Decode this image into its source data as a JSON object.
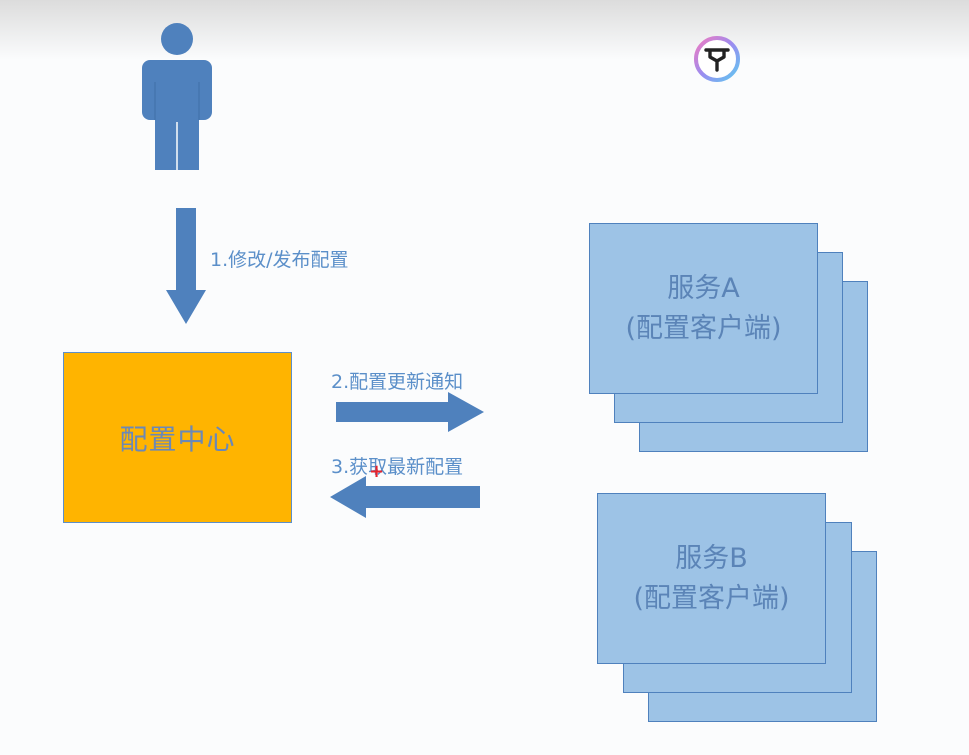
{
  "steps": {
    "step1": "1.修改/发布配置",
    "step2": "2.配置更新通知",
    "step3": "3.获取最新配置"
  },
  "config_center": {
    "label": "配置中心"
  },
  "services": [
    {
      "name": "服务A",
      "role": "(配置客户端)"
    },
    {
      "name": "服务B",
      "role": "(配置客户端)"
    }
  ],
  "colors": {
    "arrow": "#4f81bd",
    "label_text": "#5b8fc9",
    "config_center_fill": "#ffb400",
    "service_fill": "#9dc3e6",
    "cursor": "#e8232b"
  },
  "icons": [
    "person-icon",
    "down-arrow-icon",
    "right-arrow-icon",
    "left-arrow-icon",
    "cursor-crosshair-icon",
    "logo-icon"
  ]
}
